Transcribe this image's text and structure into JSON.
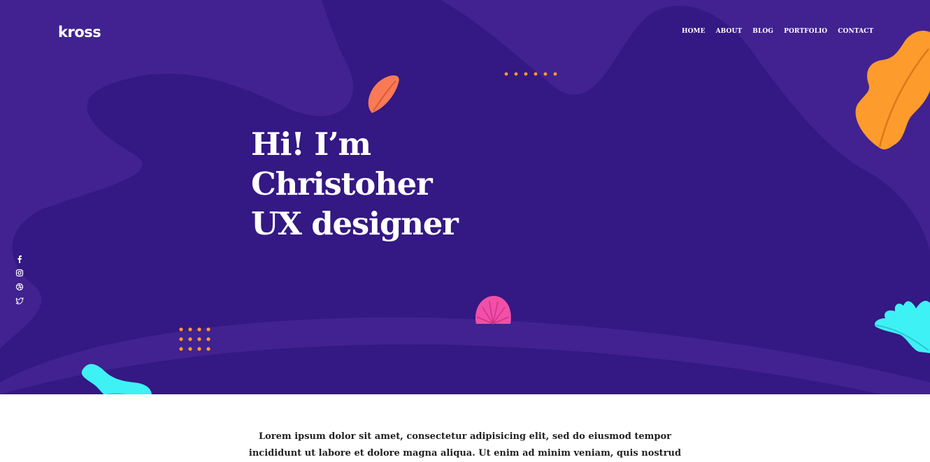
{
  "brand": {
    "logo": "kross"
  },
  "nav": {
    "items": [
      "HOME",
      "ABOUT",
      "BLOG",
      "PORTFOLIO",
      "CONTACT"
    ]
  },
  "hero": {
    "line1": "Hi! I’m",
    "line2": "Christoher",
    "line3": "UX designer"
  },
  "social": [
    "facebook-icon",
    "instagram-icon",
    "dribbble-icon",
    "twitter-icon"
  ],
  "intro": {
    "line1": "Lorem ipsum dolor sit amet, consectetur adipisicing elit, sed do eiusmod tempor",
    "line2": "incididunt ut labore et dolore magna aliqua. Ut enim ad minim veniam, quis nostrud"
  },
  "colors": {
    "hero_bg": "#412290",
    "hero_shape": "#341883",
    "orange": "#fd9b2c",
    "coral": "#f97a54",
    "pink": "#f24fa8",
    "cyan": "#3ef1f5"
  }
}
